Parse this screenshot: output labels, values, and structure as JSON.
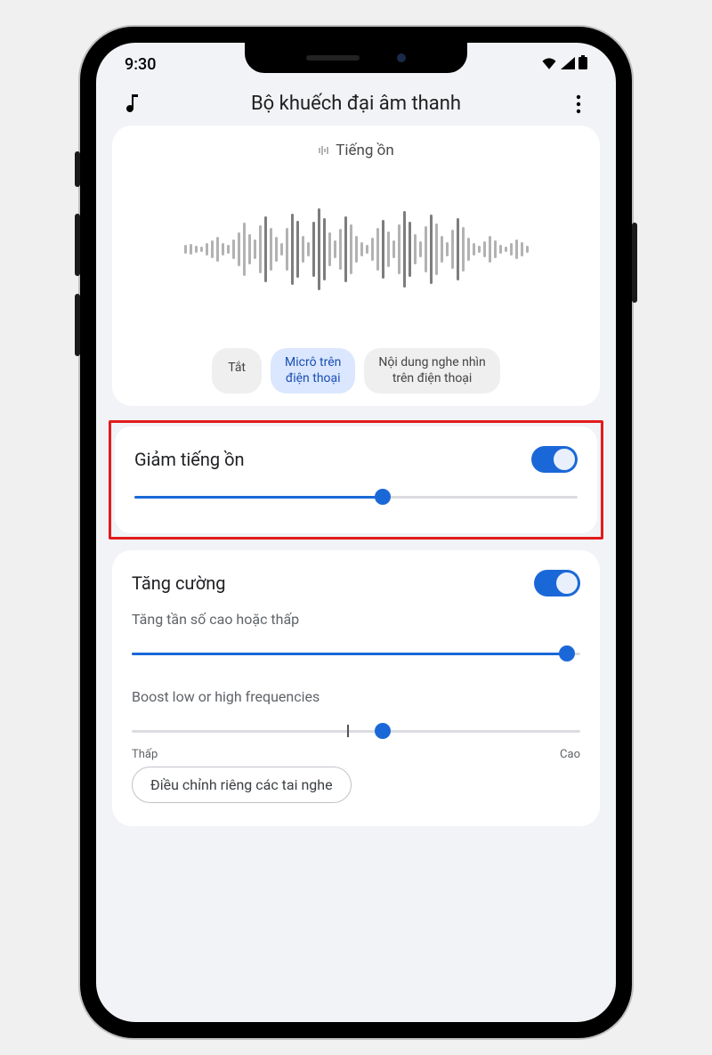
{
  "status": {
    "time": "9:30"
  },
  "appbar": {
    "title": "Bộ khuếch đại âm thanh"
  },
  "noise_card": {
    "title": "Tiếng ồn",
    "chips": [
      {
        "label": "Tắt",
        "selected": false
      },
      {
        "label": "Micrô trên\nđiện thoại",
        "selected": true
      },
      {
        "label": "Nội dung nghe nhìn\ntrên điện thoại",
        "selected": false
      }
    ]
  },
  "reduce_noise": {
    "label": "Giảm tiếng ồn",
    "enabled": true,
    "slider_percent": 56
  },
  "boost": {
    "label": "Tăng cường",
    "enabled": true,
    "sub1": "Tăng tần số cao hoặc thấp",
    "slider1_percent": 97,
    "sub2": "Boost low or high frequencies",
    "slider2_percent": 56,
    "slider2_tick_percent": 48,
    "scale_low": "Thấp",
    "scale_high": "Cao",
    "button": "Điều chỉnh riêng các tai nghe"
  },
  "waveform_bars": [
    10,
    12,
    8,
    6,
    14,
    20,
    28,
    14,
    10,
    22,
    38,
    60,
    34,
    22,
    54,
    74,
    48,
    28,
    14,
    48,
    80,
    64,
    30,
    16,
    62,
    92,
    70,
    38,
    20,
    46,
    74,
    56,
    30,
    16,
    10,
    26,
    48,
    66,
    40,
    20,
    56,
    86,
    62,
    34,
    18,
    52,
    78,
    58,
    30,
    16,
    44,
    70,
    50,
    26,
    14,
    8,
    18,
    30,
    20,
    10,
    6,
    14,
    22,
    16,
    8
  ]
}
